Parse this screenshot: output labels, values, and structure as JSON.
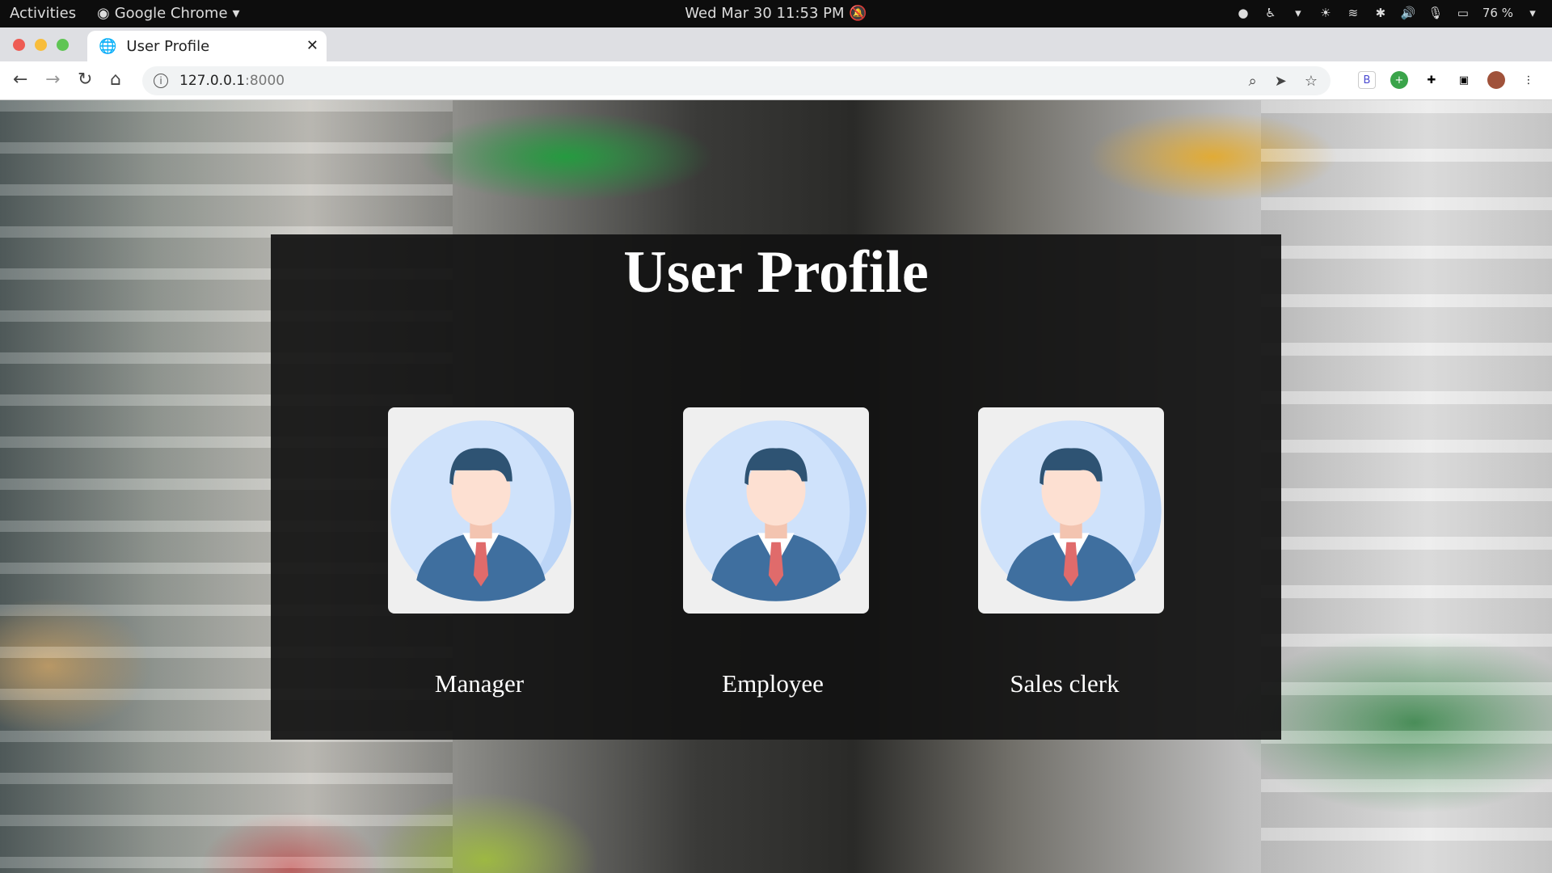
{
  "system_bar": {
    "activities": "Activities",
    "app_name": "Google Chrome",
    "datetime": "Wed Mar 30  11:53 PM",
    "battery": "76 %"
  },
  "browser": {
    "tab_title": "User Profile",
    "url_host": "127.0.0.1",
    "url_port": ":8000",
    "extension_badge": "B"
  },
  "page": {
    "title": "User Profile",
    "roles": [
      {
        "label": "Manager"
      },
      {
        "label": "Employee"
      },
      {
        "label": "Sales clerk"
      }
    ]
  },
  "colors": {
    "panel_bg": "#121212",
    "avatar_bg": "#cfe2fb",
    "suit": "#3f6f9f",
    "tie": "#e06b6b",
    "hair": "#2e5373"
  }
}
